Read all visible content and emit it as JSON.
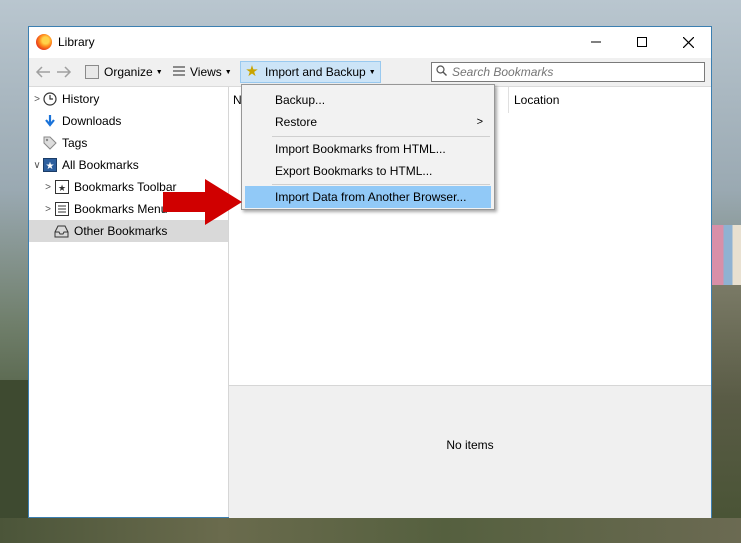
{
  "window": {
    "title": "Library"
  },
  "toolbar": {
    "organize_label": "Organize",
    "views_label": "Views",
    "import_label": "Import and Backup",
    "search_placeholder": "Search Bookmarks"
  },
  "sidebar": {
    "items": [
      {
        "label": "History",
        "icon": "clock-icon"
      },
      {
        "label": "Downloads",
        "icon": "download-arrow-icon"
      },
      {
        "label": "Tags",
        "icon": "tag-icon"
      },
      {
        "label": "All Bookmarks",
        "icon": "bookmarks-star-icon"
      },
      {
        "label": "Bookmarks Toolbar",
        "icon": "toolbar-star-icon"
      },
      {
        "label": "Bookmarks Menu",
        "icon": "menu-list-icon"
      },
      {
        "label": "Other Bookmarks",
        "icon": "tray-icon"
      }
    ]
  },
  "content": {
    "col_name_partial": "N",
    "col_location": "Location",
    "no_items": "No items"
  },
  "menu": {
    "items": [
      {
        "label": "Backup..."
      },
      {
        "label": "Restore"
      },
      {
        "label": "Import Bookmarks from HTML..."
      },
      {
        "label": "Export Bookmarks to HTML..."
      },
      {
        "label": "Import Data from Another Browser..."
      }
    ]
  },
  "colors": {
    "menu_highlight": "#91c9f7",
    "button_active": "#cce4f7",
    "annotation_arrow": "#d00000",
    "window_border": "#3c7fb1"
  }
}
